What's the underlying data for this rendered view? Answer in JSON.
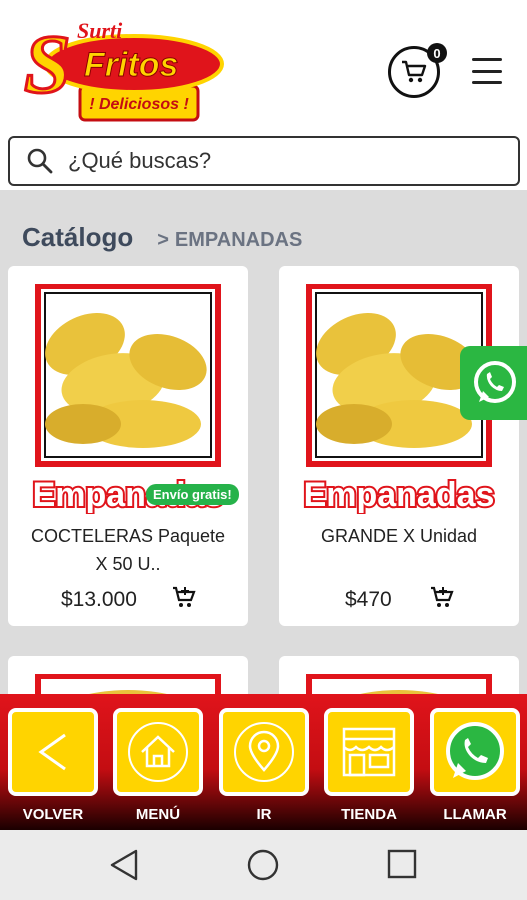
{
  "logo": {
    "top": "Surti",
    "main": "Fritos",
    "tagline": "! Deliciosos !"
  },
  "header": {
    "cart_count": "0",
    "icons": [
      "cart-icon",
      "hamburger-menu-icon"
    ]
  },
  "search": {
    "placeholder": "¿Qué buscas?",
    "icon": "search-icon"
  },
  "breadcrumb": {
    "title": "Catálogo",
    "separator": ">",
    "current": "EMPANADAS"
  },
  "products": [
    {
      "image_caption": "Empanadas",
      "badge": "Envío gratis!",
      "name_line1": "COCTELERAS Paquete",
      "name_line2": "X 50 U..",
      "price": "$13.000"
    },
    {
      "image_caption": "Empanadas",
      "name_line1": "GRANDE X Unidad",
      "price": "$470"
    }
  ],
  "bottom_bar": [
    {
      "label": "VOLVER",
      "icon": "back-arrow-icon"
    },
    {
      "label": "MENÚ",
      "icon": "home-icon"
    },
    {
      "label": "IR",
      "icon": "location-pin-icon"
    },
    {
      "label": "TIENDA",
      "icon": "store-icon"
    },
    {
      "label": "LLAMAR",
      "icon": "whatsapp-icon"
    }
  ],
  "colors": {
    "brand_red": "#e0141b",
    "brand_yellow": "#ffd400",
    "whatsapp_green": "#2bb742",
    "badge_green": "#26b24a"
  }
}
